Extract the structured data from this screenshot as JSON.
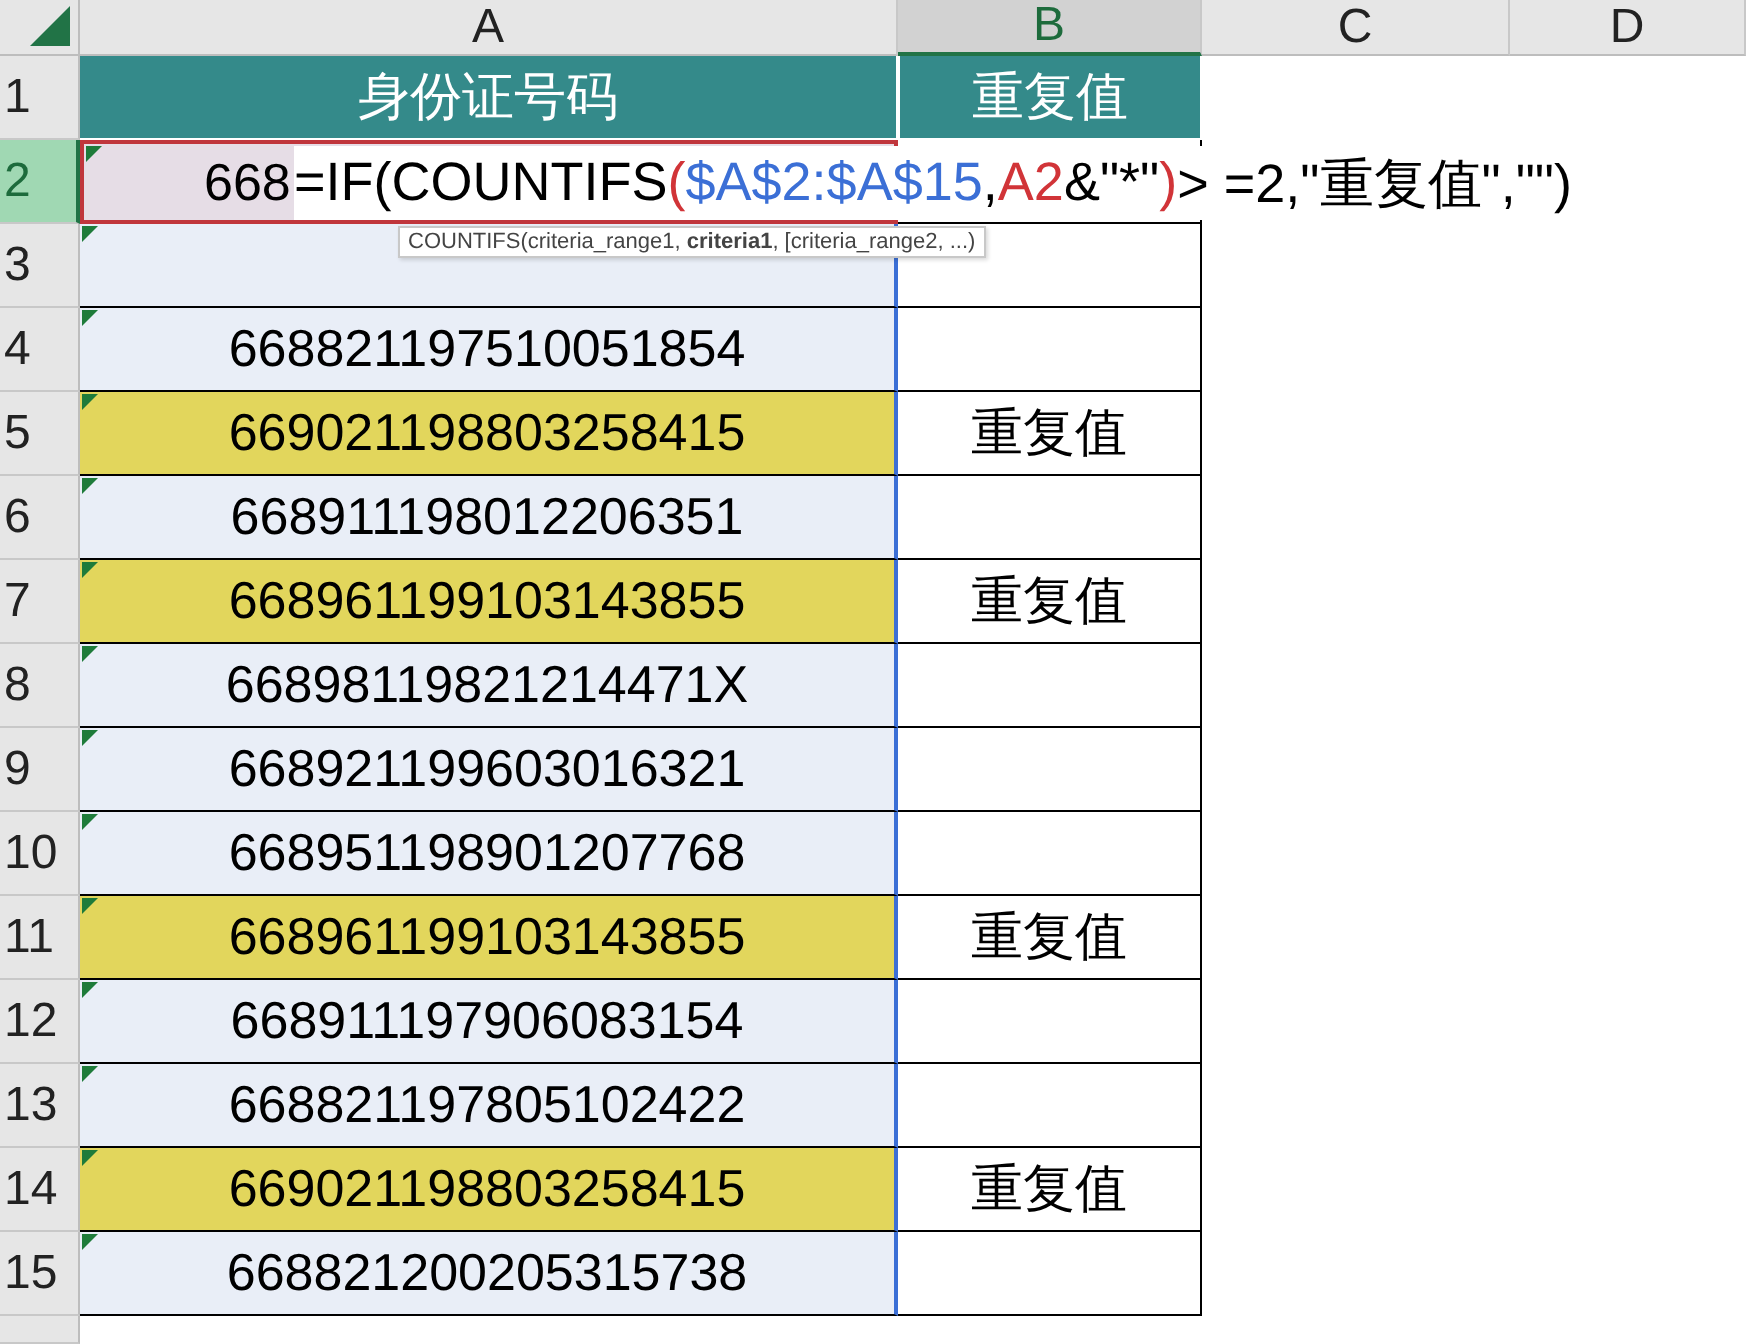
{
  "columns": [
    {
      "label": "A",
      "selected": false
    },
    {
      "label": "B",
      "selected": true
    },
    {
      "label": "C",
      "selected": false
    },
    {
      "label": "D",
      "selected": false
    }
  ],
  "header_row": {
    "row": "1",
    "a": "身份证号码",
    "b": "重复值"
  },
  "rows": [
    {
      "row": "2",
      "a": "668",
      "highlighted": false,
      "selected": true
    },
    {
      "row": "3",
      "highlighted": false,
      "selected": false
    },
    {
      "row": "4",
      "a": "668821197510051854",
      "highlighted": false,
      "selected": false
    },
    {
      "row": "5",
      "a": "669021198803258415",
      "b": "重复值",
      "highlighted": true,
      "selected": false
    },
    {
      "row": "6",
      "a": "668911198012206351",
      "highlighted": false,
      "selected": false
    },
    {
      "row": "7",
      "a": "668961199103143855",
      "b": "重复值",
      "highlighted": true,
      "selected": false
    },
    {
      "row": "8",
      "a": "66898119821214471X",
      "highlighted": false,
      "selected": false
    },
    {
      "row": "9",
      "a": "668921199603016321",
      "highlighted": false,
      "selected": false
    },
    {
      "row": "10",
      "a": "668951198901207768",
      "highlighted": false,
      "selected": false
    },
    {
      "row": "11",
      "a": "668961199103143855",
      "b": "重复值",
      "highlighted": true,
      "selected": false
    },
    {
      "row": "12",
      "a": "668911197906083154",
      "highlighted": false,
      "selected": false
    },
    {
      "row": "13",
      "a": "668821197805102422",
      "highlighted": false,
      "selected": false
    },
    {
      "row": "14",
      "a": "669021198803258415",
      "b": "重复值",
      "highlighted": true,
      "selected": false
    },
    {
      "row": "15",
      "a": "668821200205315738",
      "highlighted": false,
      "selected": false
    }
  ],
  "formula": {
    "segments": [
      {
        "text": "=IF(COUNTIFS",
        "color": "#000000"
      },
      {
        "text": "(",
        "color": "#d13438"
      },
      {
        "text": "$A$2:$A$15",
        "color": "#3b6fd6"
      },
      {
        "text": ",",
        "color": "#000000"
      },
      {
        "text": "A2",
        "color": "#d13438"
      },
      {
        "text": "&\"*\"",
        "color": "#000000"
      },
      {
        "text": ")",
        "color": "#d13438"
      },
      {
        "text": "> =2,\"重复值\",\"\")",
        "color": "#000000"
      }
    ]
  },
  "tooltip": {
    "text": "COUNTIFS(criteria_range1, **criteria1**, [criteria_range2, ...)"
  }
}
